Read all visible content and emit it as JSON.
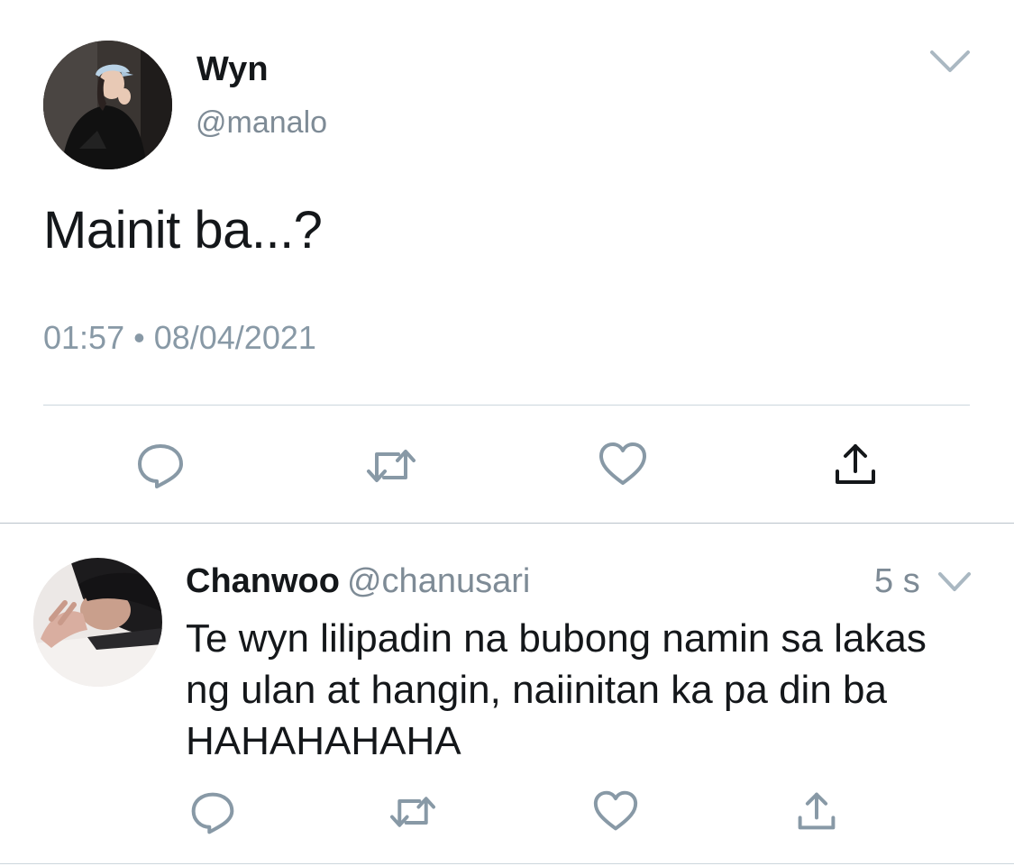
{
  "main_tweet": {
    "display_name": "Wyn",
    "handle": "@manalo",
    "text": "Mainit ba...?",
    "time": "01:57",
    "separator": "•",
    "date": "08/04/2021",
    "avatar_icon": "profile-photo",
    "actions": [
      "reply-icon",
      "retweet-icon",
      "like-icon",
      "share-icon"
    ]
  },
  "reply_tweet": {
    "display_name": "Chanwoo",
    "handle": "@chanusari",
    "time": "5 s",
    "text": "Te wyn lilipadin na bubong namin sa lakas ng ulan at hangin, naiinitan ka pa din ba HAHAHAHAHA",
    "avatar_icon": "profile-photo",
    "actions": [
      "reply-icon",
      "retweet-icon",
      "like-icon",
      "share-icon"
    ]
  },
  "colors": {
    "text": "#14171a",
    "secondary_text": "#7e8b96",
    "icon": "#8899a6",
    "divider": "#ccd6dd"
  }
}
